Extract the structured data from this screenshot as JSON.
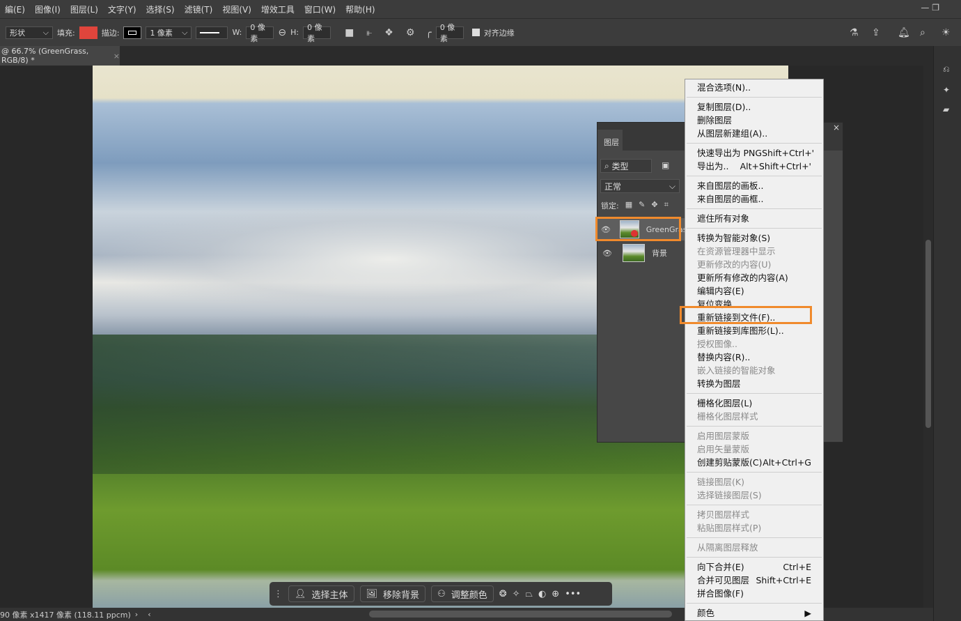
{
  "menubar": [
    "編(E)",
    "图像(I)",
    "图层(L)",
    "文字(Y)",
    "选择(S)",
    "滤镜(T)",
    "视图(V)",
    "增效工具",
    "窗口(W)",
    "帮助(H)"
  ],
  "options": {
    "shape_mode": "形状",
    "fill_label": "填充:",
    "fill_color": "#e0453c",
    "stroke_label": "描边:",
    "stroke_width": "1 像素",
    "w_label": "W:",
    "w_value": "0 像素",
    "h_label": "H:",
    "h_value": "0 像素",
    "radius_value": "0 像素",
    "align_edges": "对齐边缘"
  },
  "tab": {
    "title": "@ 66.7% (GreenGrass, RGB/8) *",
    "close": "×"
  },
  "status": {
    "text": "90 像素 x1417 像素 (118.11 ppcm)",
    "arrow": "›",
    "left_arrow": "‹"
  },
  "layers": {
    "tab": "图层",
    "filter": "类型",
    "blend": "正常",
    "lock_label": "锁定:",
    "items": [
      {
        "name": "GreenGrass",
        "visible": true,
        "selected": true
      },
      {
        "name": "背景",
        "visible": true,
        "selected": false
      }
    ]
  },
  "context_menu": {
    "groups": [
      [
        {
          "label": "混合选项(N).."
        }
      ],
      [
        {
          "label": "复制图层(D).."
        },
        {
          "label": "删除图层"
        },
        {
          "label": "从图层新建组(A).."
        }
      ],
      [
        {
          "label": "快速导出为 PNG",
          "shortcut": "Shift+Ctrl+'"
        },
        {
          "label": "导出为..",
          "shortcut": "Alt+Shift+Ctrl+'"
        }
      ],
      [
        {
          "label": "来自图层的画板.."
        },
        {
          "label": "来自图层的画框.."
        }
      ],
      [
        {
          "label": "遮住所有对象"
        }
      ],
      [
        {
          "label": "转换为智能对象(S)"
        },
        {
          "label": "在资源管理器中显示",
          "disabled": true
        },
        {
          "label": "更新修改的内容(U)",
          "disabled": true
        },
        {
          "label": "更新所有修改的内容(A)"
        },
        {
          "label": "编辑内容(E)"
        },
        {
          "label": "复位变换"
        },
        {
          "label": "重新链接到文件(F)..",
          "highlighted": true
        },
        {
          "label": "重新链接到库图形(L).."
        },
        {
          "label": "授权图像..",
          "disabled": true
        },
        {
          "label": "替换内容(R).."
        },
        {
          "label": "嵌入链接的智能对象",
          "disabled": true
        },
        {
          "label": "转换为图层"
        }
      ],
      [
        {
          "label": "栅格化图层(L)"
        },
        {
          "label": "栅格化图层样式",
          "disabled": true
        }
      ],
      [
        {
          "label": "启用图层蒙版",
          "disabled": true
        },
        {
          "label": "启用矢量蒙版",
          "disabled": true
        },
        {
          "label": "创建剪贴蒙版(C)",
          "shortcut": "Alt+Ctrl+G"
        }
      ],
      [
        {
          "label": "链接图层(K)",
          "disabled": true
        },
        {
          "label": "选择链接图层(S)",
          "disabled": true
        }
      ],
      [
        {
          "label": "拷贝图层样式",
          "disabled": true
        },
        {
          "label": "粘贴图层样式(P)",
          "disabled": true
        }
      ],
      [
        {
          "label": "从隔离图层释放",
          "disabled": true
        }
      ],
      [
        {
          "label": "向下合并(E)",
          "shortcut": "Ctrl+E"
        },
        {
          "label": "合并可见图层",
          "shortcut": "Shift+Ctrl+E"
        },
        {
          "label": "拼合图像(F)"
        }
      ],
      [
        {
          "label": "颜色",
          "shortcut": "▶"
        }
      ]
    ]
  },
  "taskbar": {
    "select_subject": "选择主体",
    "remove_bg": "移除背景",
    "adjust_color": "调整颜色",
    "more": "•••"
  },
  "highlight_color": "#f08a2c"
}
